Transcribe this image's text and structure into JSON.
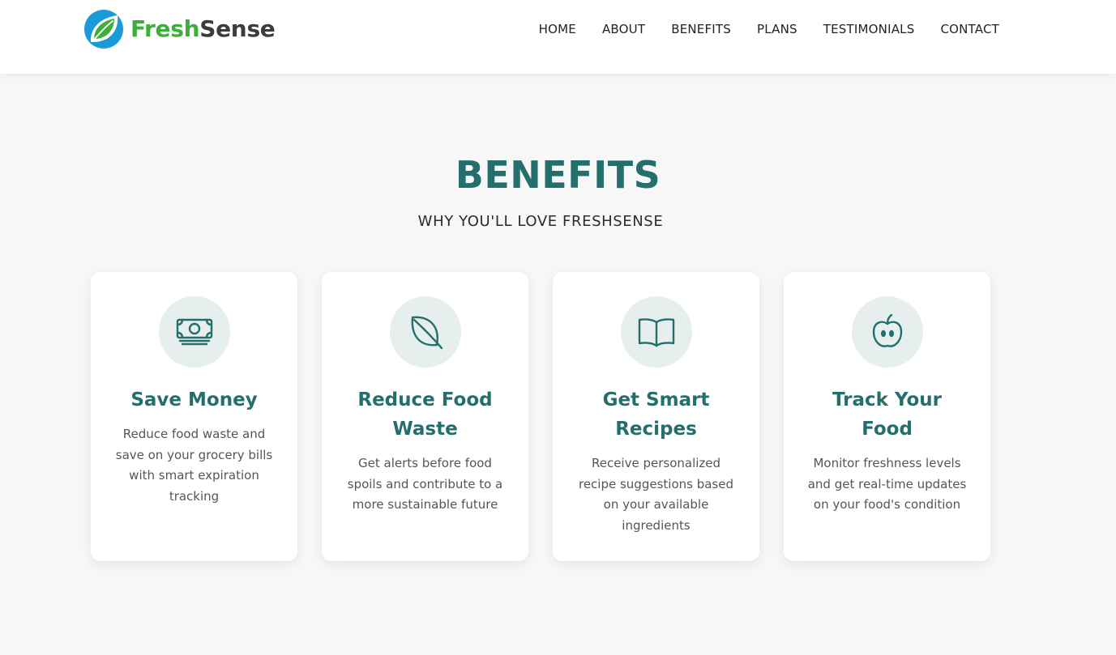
{
  "brand": {
    "name_part1": "Fresh",
    "name_part2": "Sense",
    "logo_icon": "leaf-logo-icon"
  },
  "nav": {
    "items": [
      "HOME",
      "ABOUT",
      "BENEFITS",
      "PLANS",
      "TESTIMONIALS",
      "CONTACT"
    ]
  },
  "section": {
    "title": "BENEFITS",
    "subtitle": "WHY YOU'LL LOVE FRESHSENSE"
  },
  "cards": [
    {
      "icon": "money-icon",
      "title": "Save Money",
      "description": "Reduce food waste and save on your grocery bills with smart expiration tracking"
    },
    {
      "icon": "leaf-icon",
      "title": "Reduce Food Waste",
      "description": "Get alerts before food spoils and contribute to a more sustainable future"
    },
    {
      "icon": "book-icon",
      "title": "Get Smart Recipes",
      "description": "Receive personalized recipe suggestions based on your available ingredients"
    },
    {
      "icon": "apple-icon",
      "title": "Track Your Food",
      "description": "Monitor freshness levels and get real-time updates on your food's condition"
    }
  ],
  "colors": {
    "accent": "#246f6c",
    "brand_green": "#3dae3a",
    "logo_blue": "#1a9ad6",
    "icon_bg": "#e6efee"
  }
}
